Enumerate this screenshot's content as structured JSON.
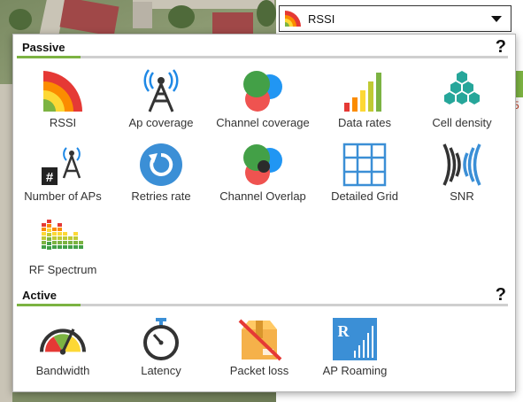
{
  "view_select": {
    "selected": "RSSI",
    "icon": "rssi-heatmap-icon"
  },
  "edge": {
    "number": "5",
    "accent_color": "#7cb342"
  },
  "passive": {
    "title": "Passive",
    "help": "?",
    "items": [
      {
        "label": "RSSI",
        "icon": "rssi-heatmap-icon"
      },
      {
        "label": "Ap coverage",
        "icon": "antenna-tower-icon"
      },
      {
        "label": "Channel coverage",
        "icon": "channel-circles-icon"
      },
      {
        "label": "Data rates",
        "icon": "data-rates-bars-icon"
      },
      {
        "label": "Cell density",
        "icon": "hexagon-cluster-icon"
      },
      {
        "label": "Number of APs",
        "icon": "number-of-aps-icon"
      },
      {
        "label": "Retries rate",
        "icon": "retry-arrow-icon"
      },
      {
        "label": "Channel Overlap",
        "icon": "channel-overlap-icon"
      },
      {
        "label": "Detailed Grid",
        "icon": "grid-icon"
      },
      {
        "label": "SNR",
        "icon": "snr-waves-icon"
      },
      {
        "label": "RF Spectrum",
        "icon": "rf-spectrum-icon"
      }
    ]
  },
  "active": {
    "title": "Active",
    "help": "?",
    "items": [
      {
        "label": "Bandwidth",
        "icon": "gauge-icon"
      },
      {
        "label": "Latency",
        "icon": "stopwatch-icon"
      },
      {
        "label": "Packet loss",
        "icon": "crossed-package-icon"
      },
      {
        "label": "AP Roaming",
        "icon": "ap-roaming-icon"
      }
    ]
  },
  "colors": {
    "accent_green": "#7cb342",
    "divider": "#cfcfcf",
    "label_text": "#333333"
  }
}
